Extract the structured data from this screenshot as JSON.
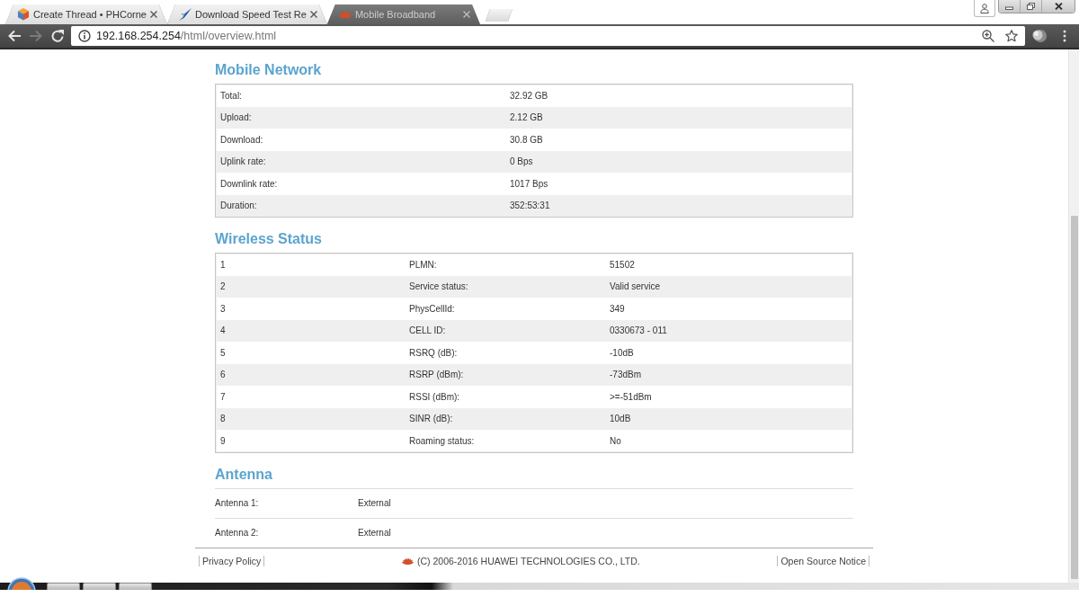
{
  "browser": {
    "tabs": [
      {
        "title": "Create Thread • PHCorne",
        "selected": false
      },
      {
        "title": "Download Speed Test Re",
        "selected": false
      },
      {
        "title": "Mobile Broadband",
        "selected": true
      }
    ],
    "nav_buttons": [
      {
        "kind": "back",
        "disabled": false
      },
      {
        "kind": "forward",
        "disabled": true
      },
      {
        "kind": "reload",
        "disabled": false
      }
    ],
    "address": {
      "host": "192.168.254.254",
      "path": "/html/overview.html"
    }
  },
  "mobile_network": {
    "title": "Mobile Network",
    "rows": [
      {
        "label": "Total:",
        "value": "32.92 GB"
      },
      {
        "label": "Upload:",
        "value": "2.12 GB"
      },
      {
        "label": "Download:",
        "value": "30.8 GB"
      },
      {
        "label": "Uplink rate:",
        "value": "0 Bps"
      },
      {
        "label": "Downlink rate:",
        "value": "1017 Bps"
      },
      {
        "label": "Duration:",
        "value": "352:53:31"
      }
    ]
  },
  "wireless_status": {
    "title": "Wireless Status",
    "rows": [
      {
        "index": "1",
        "label": "PLMN:",
        "value": "51502"
      },
      {
        "index": "2",
        "label": "Service status:",
        "value": "Valid service"
      },
      {
        "index": "3",
        "label": "PhysCellId:",
        "value": "349"
      },
      {
        "index": "4",
        "label": "CELL ID:",
        "value": "0330673 - 011"
      },
      {
        "index": "5",
        "label": "RSRQ (dB):",
        "value": "-10dB"
      },
      {
        "index": "6",
        "label": "RSRP (dBm):",
        "value": "-73dBm"
      },
      {
        "index": "7",
        "label": "RSSI (dBm):",
        "value": ">=-51dBm"
      },
      {
        "index": "8",
        "label": "SINR (dB):",
        "value": "10dB"
      },
      {
        "index": "9",
        "label": "Roaming status:",
        "value": "No"
      }
    ]
  },
  "antenna": {
    "title": "Antenna",
    "rows": [
      {
        "label": "Antenna 1:",
        "value": "External"
      },
      {
        "label": "Antenna 2:",
        "value": "External"
      }
    ]
  },
  "footer": {
    "privacy_link": "Privacy Policy",
    "copyright": "(C) 2006-2016 HUAWEI TECHNOLOGIES CO., LTD.",
    "notice_link": "Open Source Notice"
  }
}
